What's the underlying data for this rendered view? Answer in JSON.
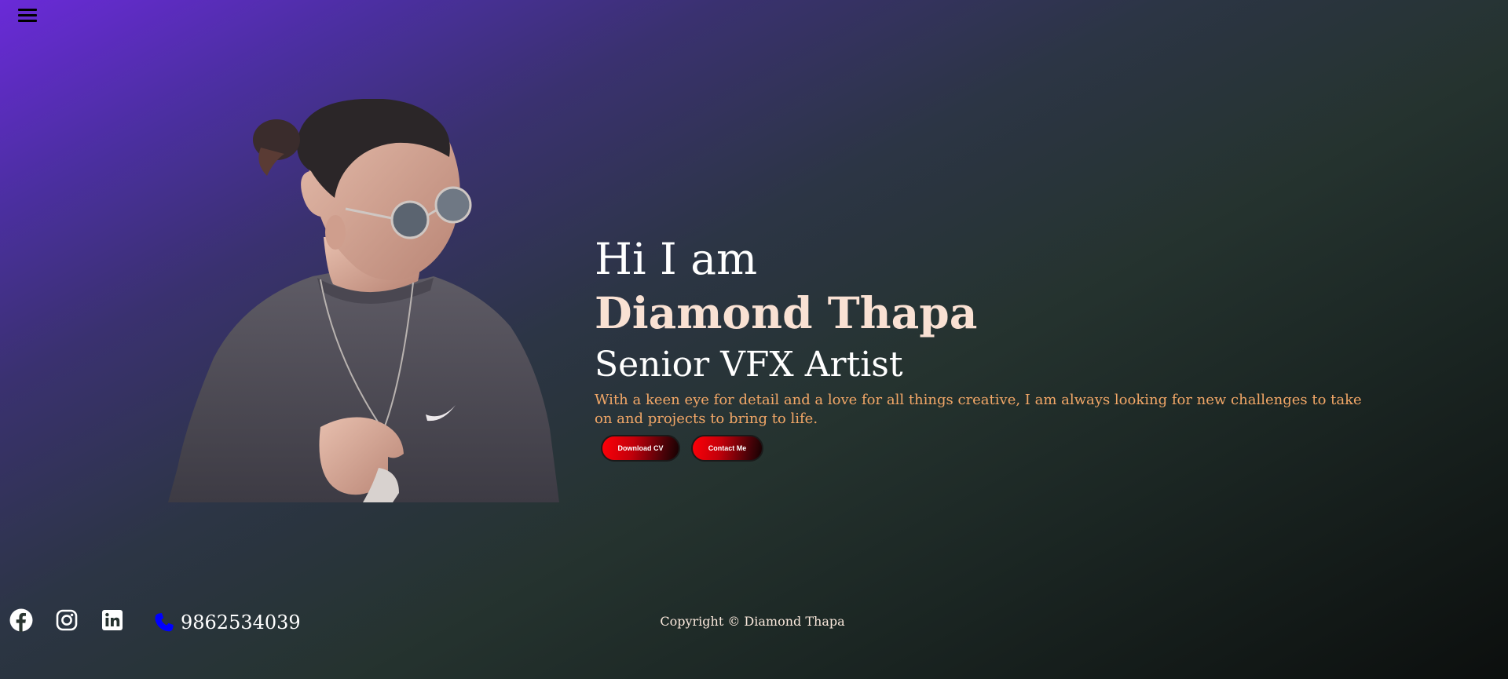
{
  "nav": {
    "menu_icon": "hamburger-menu-icon"
  },
  "hero": {
    "greeting": "Hi I am",
    "name": "Diamond Thapa",
    "role": "Senior VFX Artist",
    "intro": "With a keen eye for detail and a love for all things creative, I am always looking for new challenges to take on and projects to bring to life.",
    "buttons": {
      "download_cv": "Download CV",
      "contact_me": "Contact Me"
    }
  },
  "footer": {
    "social": [
      {
        "name": "facebook-icon"
      },
      {
        "name": "instagram-icon"
      },
      {
        "name": "linkedin-icon"
      }
    ],
    "phone": {
      "icon": "phone-icon",
      "number": "9862534039"
    },
    "copyright": "Copyright © Diamond Thapa"
  },
  "colors": {
    "accent_button": "#e00009",
    "name_text": "#f9e1d3",
    "intro_text": "#f2a767",
    "phone_icon": "#0000ff",
    "background_top": "#6a2ad8",
    "background_bottom": "#0c0f0e"
  }
}
